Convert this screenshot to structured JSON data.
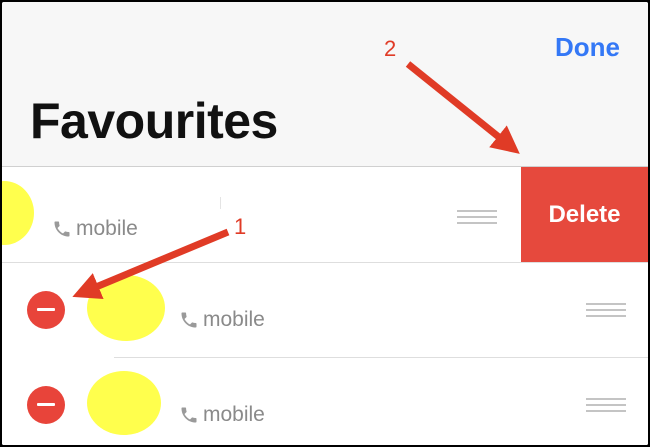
{
  "header": {
    "done_label": "Done",
    "title": "Favourites"
  },
  "favourites": [
    {
      "label": "mobile",
      "icon": "phone-icon",
      "state": "swiped-delete"
    },
    {
      "label": "mobile",
      "icon": "phone-icon",
      "state": "edit"
    },
    {
      "label": "mobile",
      "icon": "phone-icon",
      "state": "edit"
    }
  ],
  "delete_label": "Delete",
  "annotations": {
    "first": "1",
    "second": "2"
  },
  "colors": {
    "accent": "#3478f6",
    "delete": "#e6493d",
    "minus": "#e8443a",
    "avatar": "#ffff4d",
    "annotation": "#e03b26"
  }
}
